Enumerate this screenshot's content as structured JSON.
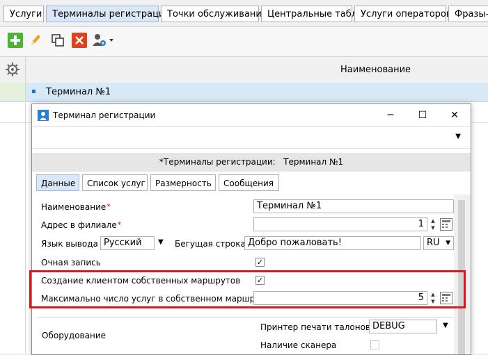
{
  "tabs": [
    {
      "label": "Услуги"
    },
    {
      "label": "Терминалы регистрации"
    },
    {
      "label": "Точки обслуживания"
    },
    {
      "label": "Центральные табло"
    },
    {
      "label": "Услуги операторов"
    },
    {
      "label": "Фразы-п"
    }
  ],
  "grid": {
    "column_header": "Наименование",
    "rows": [
      {
        "label": "Терминал №1"
      }
    ]
  },
  "dialog": {
    "title": "Терминал регистрации",
    "banner_left": "*Терминалы регистрации:",
    "banner_right": "Терминал №1",
    "tabs": [
      {
        "label": "Данные"
      },
      {
        "label": "Список услуг"
      },
      {
        "label": "Размерность"
      },
      {
        "label": "Сообщения"
      }
    ],
    "fields": {
      "name_label": "Наименование",
      "name_value": "Терминал №1",
      "address_label": "Адрес в филиале",
      "address_value": "1",
      "language_label": "Язык вывода",
      "language_value": "Русский",
      "ticker_label": "Бегущая строка",
      "ticker_value": "Добро пожаловать!",
      "ticker_lang": "RU",
      "inperson_label": "Очная запись",
      "routes_label": "Создание клиентом собственных маршрутов",
      "max_services_label": "Максимально число услуг в собственном маршруте",
      "max_services_value": "5"
    },
    "equipment": {
      "group_label": "Оборудование",
      "printer_label": "Принтер печати талонов",
      "printer_value": "DEBUG",
      "scanner_label": "Наличие сканера"
    },
    "required_mark": "*"
  }
}
